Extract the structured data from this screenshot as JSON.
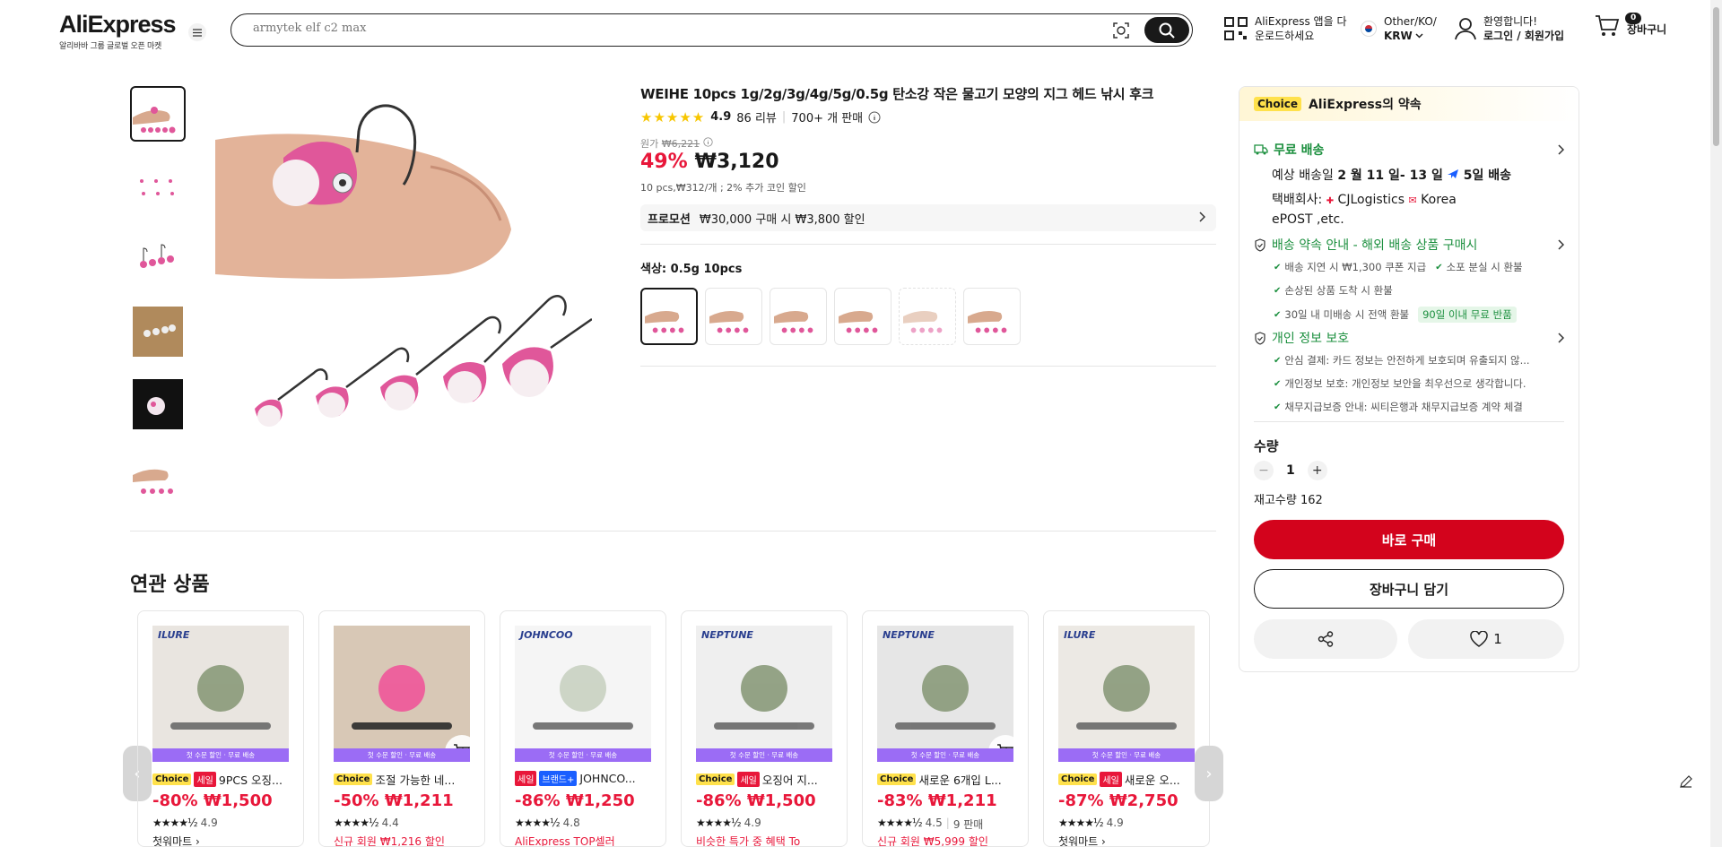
{
  "header": {
    "logo_text": "AliExpress",
    "logo_sub": "알리바바 그룹 글로벌 오픈 마켓",
    "search_placeholder": "armytek elf c2 max",
    "app_line1": "AliExpress 앱을 다",
    "app_line2": "운로드하세요",
    "locale_line1": "Other/KO/",
    "locale_line2": "KRW",
    "account_line1": "환영합니다!",
    "account_line2": "로그인 / 회원가입",
    "cart_count": "0",
    "cart_label": "장바구니"
  },
  "product": {
    "title": "WEIHE 10pcs 1g/2g/3g/4g/5g/0.5g 탄소강 작은 물고기 모양의 지그 헤드 낚시 후크",
    "rating": "4.9",
    "reviews": "86 리뷰",
    "sold": "700+ 개 판매",
    "orig_label": "원가",
    "orig_price": "₩6,221",
    "discount": "49%",
    "price": "₩3,120",
    "unit_info": "10 pcs,₩312/개 ; 2% 추가 코인 할인",
    "promo_tag": "프로모션",
    "promo_text": "₩30,000 구매 시 ₩3,800 할인",
    "color_label": "색상: 0.5g 10pcs"
  },
  "panel": {
    "choice_tag": "Choice",
    "choice_title": "AliExpress의 약속",
    "shipping_title": "무료 배송",
    "delivery_prefix": "예상 배송일",
    "delivery_dates": "2 월 11 일- 13 일",
    "delivery_days": "5일 배송",
    "carrier_label": "택배회사:",
    "carrier_1": "CJLogistics",
    "carrier_2": "Korea",
    "carrier_3": "ePOST ,etc.",
    "guarantee_title": "배송 약속 안내 - 해외 배송 상품 구매시",
    "g1": "배송 지연 시 ₩1,300 쿠폰 지급",
    "g2": "소포 분실 시 환불",
    "g3": "손상된 상품 도착 시 환불",
    "g4": "30일 내 미배송 시 전액 환불",
    "g5": "90일 이내 무료 반품",
    "privacy_title": "개인 정보 보호",
    "p1": "안심 결제: 카드 정보는 안전하게 보호되며 유출되지 않...",
    "p2": "개인정보 보호: 개인정보 보안을 최우선으로 생각합니다.",
    "p3": "채무지급보증 안내: 씨티은행과 채무지급보증 계약 체결",
    "qty_label": "수량",
    "qty_value": "1",
    "stock": "재고수량 162",
    "buy_label": "바로 구매",
    "cart_label": "장바구니 담기",
    "wish_count": "1"
  },
  "related": {
    "title": "연관 상품",
    "ribbon": "첫 수문 할인 · 무료 배송",
    "cards": [
      {
        "brand": "ILURE",
        "tags": [
          "Choice",
          "세일"
        ],
        "name": "9PCS 오징...",
        "price": "-80% ₩1,500",
        "stars": "★★★★½",
        "rating": "4.9",
        "extra_text": "",
        "sold": "",
        "extra_dark": "첫워마트 ›"
      },
      {
        "brand": "",
        "tags": [
          "Choice"
        ],
        "name": "조절 가능한 네...",
        "price": "-50% ₩1,211",
        "stars": "★★★★½",
        "rating": "4.4",
        "extra_text": "신규 회원 ₩1,216 할인",
        "sold": "",
        "extra_dark": ""
      },
      {
        "brand": "JOHNCOO",
        "tags": [
          "세일",
          "브랜드+"
        ],
        "name": "JOHNCO...",
        "price": "-86% ₩1,250",
        "stars": "★★★★½",
        "rating": "4.8",
        "extra_text": "AliExpress TOP셀러",
        "sold": "",
        "extra_dark": ""
      },
      {
        "brand": "NEPTUNE",
        "tags": [
          "Choice",
          "세일"
        ],
        "name": "오징어 지...",
        "price": "-86% ₩1,500",
        "stars": "★★★★½",
        "rating": "4.9",
        "extra_text": "비슷한 특가 중 혜택 To",
        "sold": "",
        "extra_dark": ""
      },
      {
        "brand": "NEPTUNE",
        "tags": [
          "Choice"
        ],
        "name": "새로운 6개입 L...",
        "price": "-83% ₩1,211",
        "stars": "★★★★½",
        "rating": "4.5",
        "extra_text": "신규 회원 ₩5,999 할인",
        "sold": "9 판매",
        "extra_dark": ""
      },
      {
        "brand": "ILURE",
        "tags": [
          "Choice",
          "세일"
        ],
        "name": "새로운 오...",
        "price": "-87% ₩2,750",
        "stars": "★★★★½",
        "rating": "4.9",
        "extra_text": "",
        "sold": "",
        "extra_dark": "첫워마트 ›"
      }
    ]
  },
  "colors": {
    "accent_red": "#e8173a",
    "buy_red": "#d3031c",
    "green": "#1b8f3e",
    "choice_yellow": "#ffe14b"
  }
}
